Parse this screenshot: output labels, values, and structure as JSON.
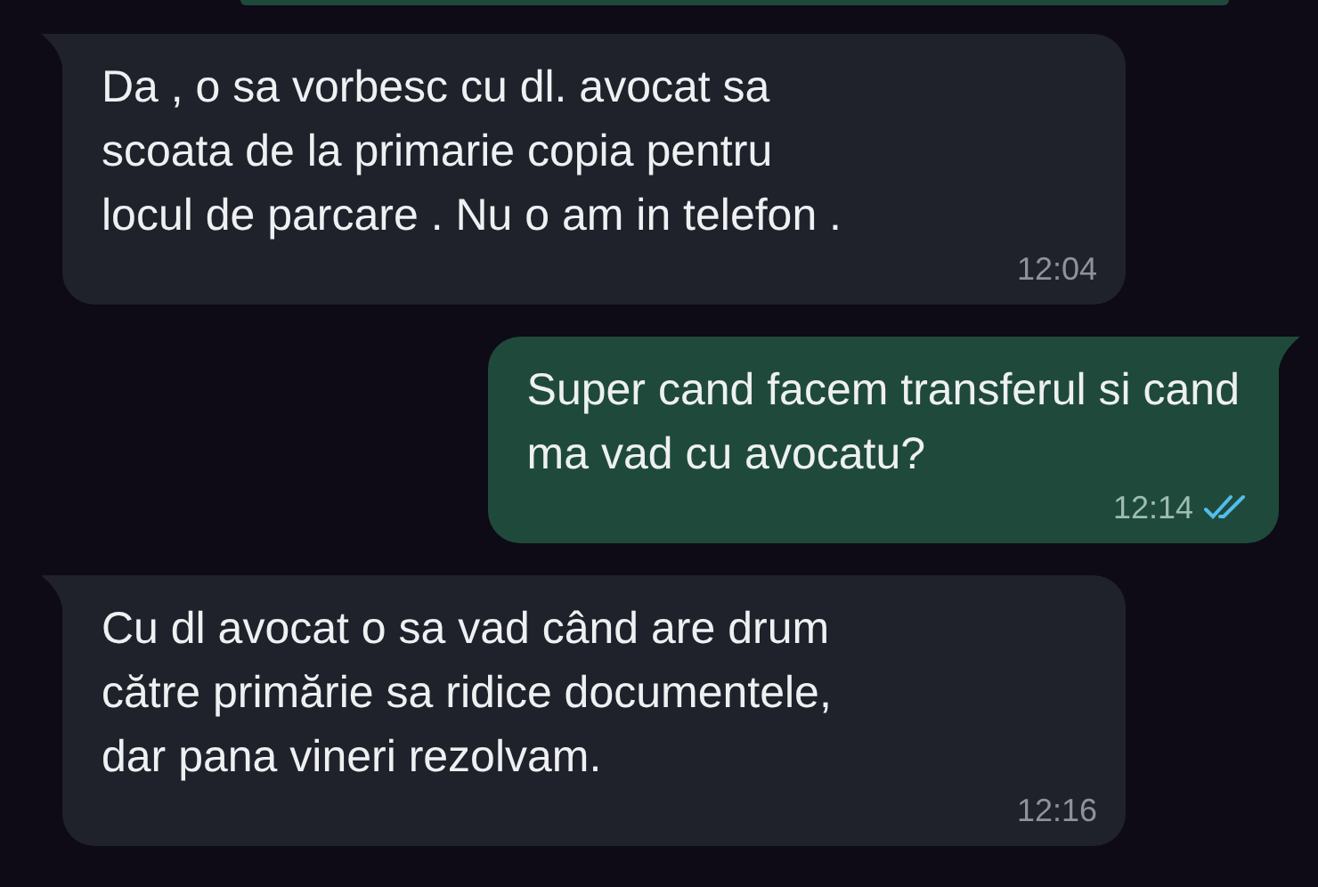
{
  "messages": [
    {
      "outgoing": false,
      "text": "Da , o sa vorbesc cu dl. avocat sa\nscoata de la primarie copia pentru\nlocul de parcare . Nu o am in telefon .",
      "time": "12:04"
    },
    {
      "outgoing": true,
      "text": "Super cand facem transferul si cand\nma vad cu avocatu?",
      "time": "12:14",
      "read": true
    },
    {
      "outgoing": false,
      "text": "Cu dl avocat o sa vad când are drum\ncătre primărie sa ridice documentele,\ndar pana vineri rezolvam.",
      "time": "12:16"
    }
  ]
}
